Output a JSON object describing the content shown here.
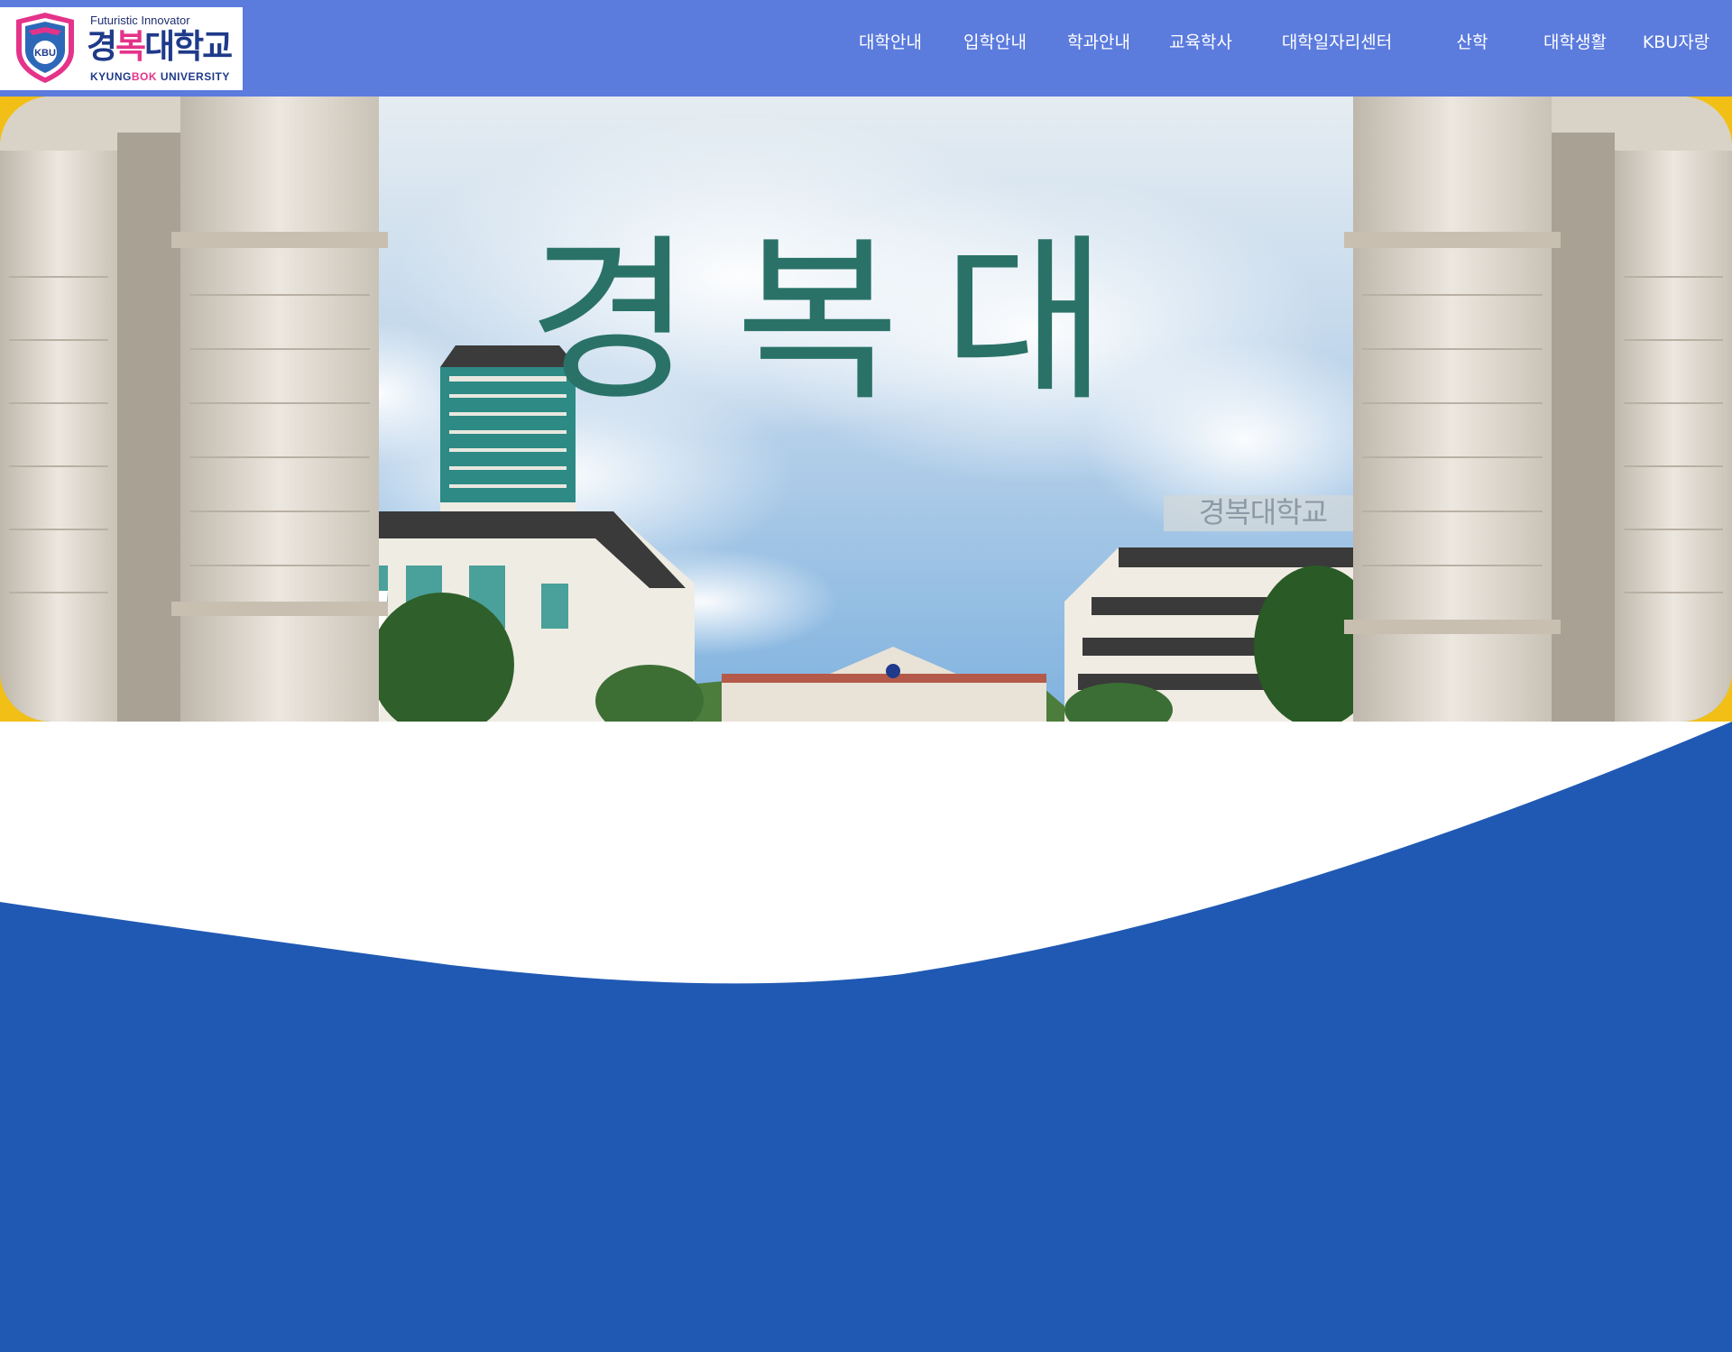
{
  "logo": {
    "tagline": "Futuristic Innovator",
    "name_part1": "경",
    "name_part2": "복",
    "name_part3": "대학교",
    "english_part1": "KYUNG",
    "english_part2": "BOK",
    "english_part3": " UNIVERSITY",
    "emblem_text": "KBU"
  },
  "nav": {
    "items": [
      {
        "label": "대학안내"
      },
      {
        "label": "입학안내"
      },
      {
        "label": "학과안내"
      },
      {
        "label": "교육학사"
      },
      {
        "label": "대학일자리센터"
      },
      {
        "label": "산학"
      },
      {
        "label": "대학생활"
      },
      {
        "label": "KBU자랑"
      }
    ]
  },
  "hero": {
    "title": "경복대",
    "building_sign": "경복대학교"
  },
  "colors": {
    "header_bg": "#5b7bdd",
    "hero_frame": "#f2bf17",
    "wave_blue": "#2059b3",
    "title_green": "#2a7268",
    "brand_navy": "#1f3a8a",
    "brand_pink": "#e5338a"
  }
}
